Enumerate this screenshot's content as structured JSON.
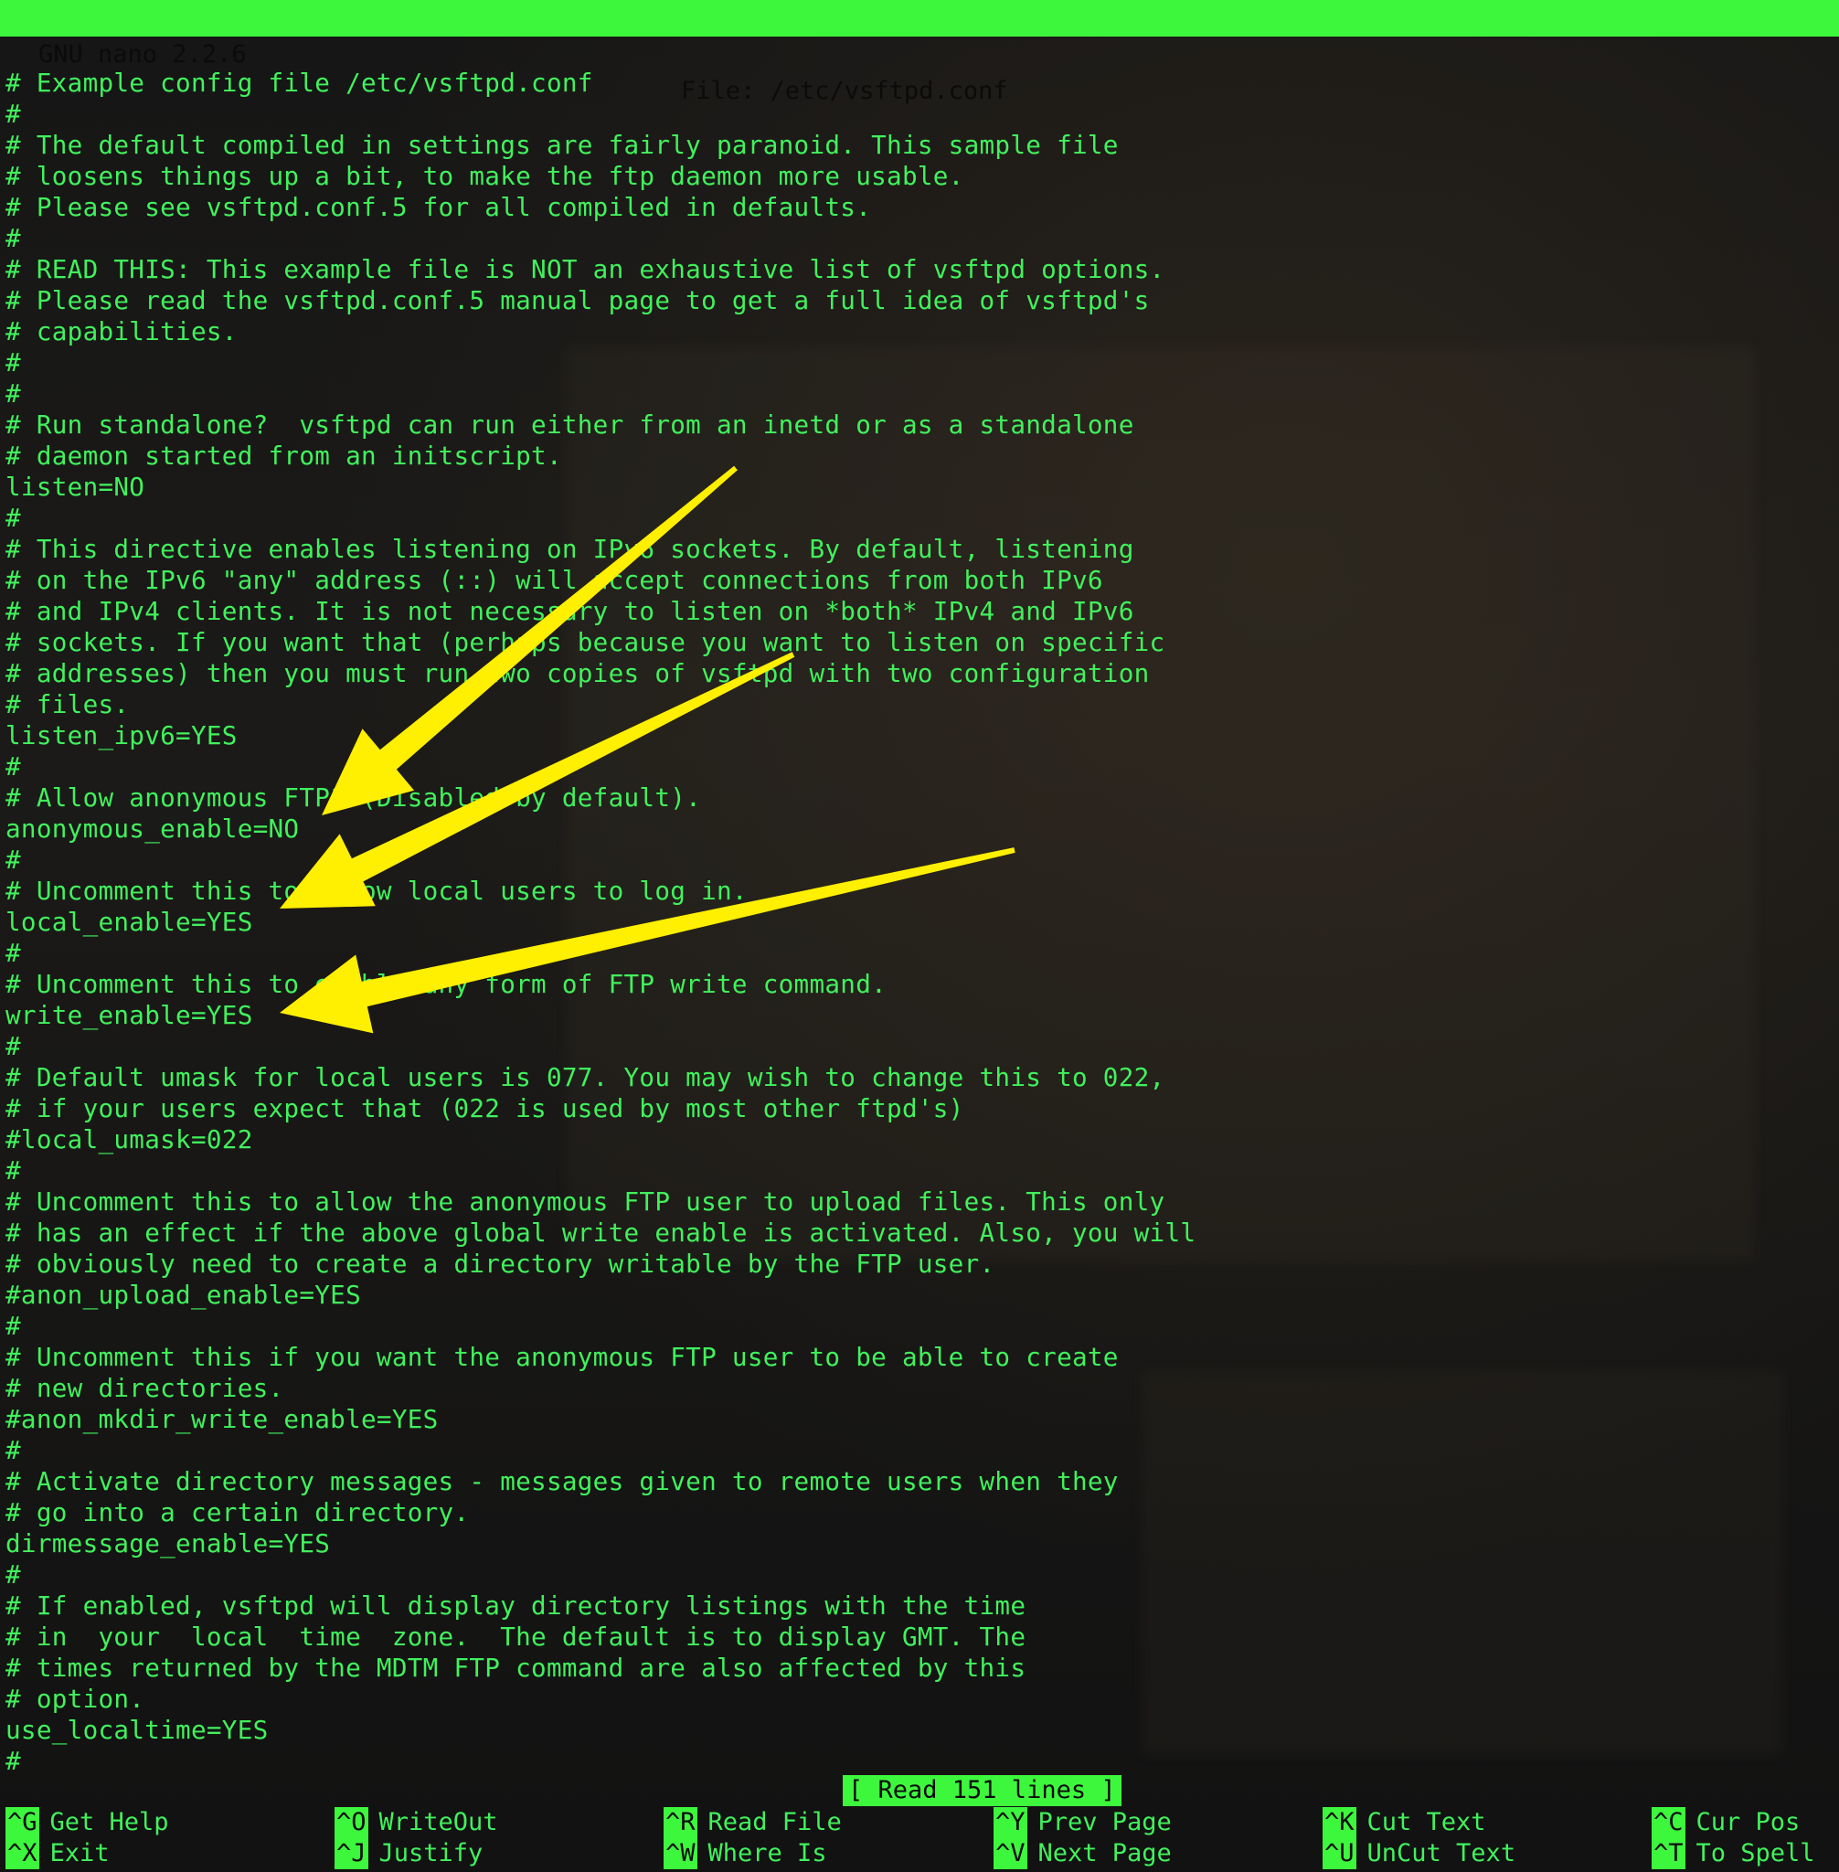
{
  "titlebar": {
    "app": "GNU nano 2.2.6",
    "file": "File: /etc/vsftpd.conf"
  },
  "editor": {
    "lines": [
      "# Example config file /etc/vsftpd.conf",
      "#",
      "# The default compiled in settings are fairly paranoid. This sample file",
      "# loosens things up a bit, to make the ftp daemon more usable.",
      "# Please see vsftpd.conf.5 for all compiled in defaults.",
      "#",
      "# READ THIS: This example file is NOT an exhaustive list of vsftpd options.",
      "# Please read the vsftpd.conf.5 manual page to get a full idea of vsftpd's",
      "# capabilities.",
      "#",
      "#",
      "# Run standalone?  vsftpd can run either from an inetd or as a standalone",
      "# daemon started from an initscript.",
      "listen=NO",
      "#",
      "# This directive enables listening on IPv6 sockets. By default, listening",
      "# on the IPv6 \"any\" address (::) will accept connections from both IPv6",
      "# and IPv4 clients. It is not necessary to listen on *both* IPv4 and IPv6",
      "# sockets. If you want that (perhaps because you want to listen on specific",
      "# addresses) then you must run two copies of vsftpd with two configuration",
      "# files.",
      "listen_ipv6=YES",
      "#",
      "# Allow anonymous FTP? (Disabled by default).",
      "anonymous_enable=NO",
      "#",
      "# Uncomment this to allow local users to log in.",
      "local_enable=YES",
      "#",
      "# Uncomment this to enable any form of FTP write command.",
      "write_enable=YES",
      "#",
      "# Default umask for local users is 077. You may wish to change this to 022,",
      "# if your users expect that (022 is used by most other ftpd's)",
      "#local_umask=022",
      "#",
      "# Uncomment this to allow the anonymous FTP user to upload files. This only",
      "# has an effect if the above global write enable is activated. Also, you will",
      "# obviously need to create a directory writable by the FTP user.",
      "#anon_upload_enable=YES",
      "#",
      "# Uncomment this if you want the anonymous FTP user to be able to create",
      "# new directories.",
      "#anon_mkdir_write_enable=YES",
      "#",
      "# Activate directory messages - messages given to remote users when they",
      "# go into a certain directory.",
      "dirmessage_enable=YES",
      "#",
      "# If enabled, vsftpd will display directory listings with the time",
      "# in  your  local  time  zone.  The default is to display GMT. The",
      "# times returned by the MDTM FTP command are also affected by this",
      "# option.",
      "use_localtime=YES",
      "#"
    ]
  },
  "status": "[ Read 151 lines ]",
  "shortcuts": [
    {
      "key": "^G",
      "label": "Get Help"
    },
    {
      "key": "^O",
      "label": "WriteOut"
    },
    {
      "key": "^R",
      "label": "Read File"
    },
    {
      "key": "^Y",
      "label": "Prev Page"
    },
    {
      "key": "^K",
      "label": "Cut Text"
    },
    {
      "key": "^C",
      "label": "Cur Pos"
    },
    {
      "key": "^X",
      "label": "Exit"
    },
    {
      "key": "^J",
      "label": "Justify"
    },
    {
      "key": "^W",
      "label": "Where Is"
    },
    {
      "key": "^V",
      "label": "Next Page"
    },
    {
      "key": "^U",
      "label": "UnCut Text"
    },
    {
      "key": "^T",
      "label": "To Spell"
    }
  ],
  "colors": {
    "text": "#41f15c",
    "bar": "#3df73d",
    "background": "#151515",
    "annotation_arrow": "#ffef00"
  }
}
